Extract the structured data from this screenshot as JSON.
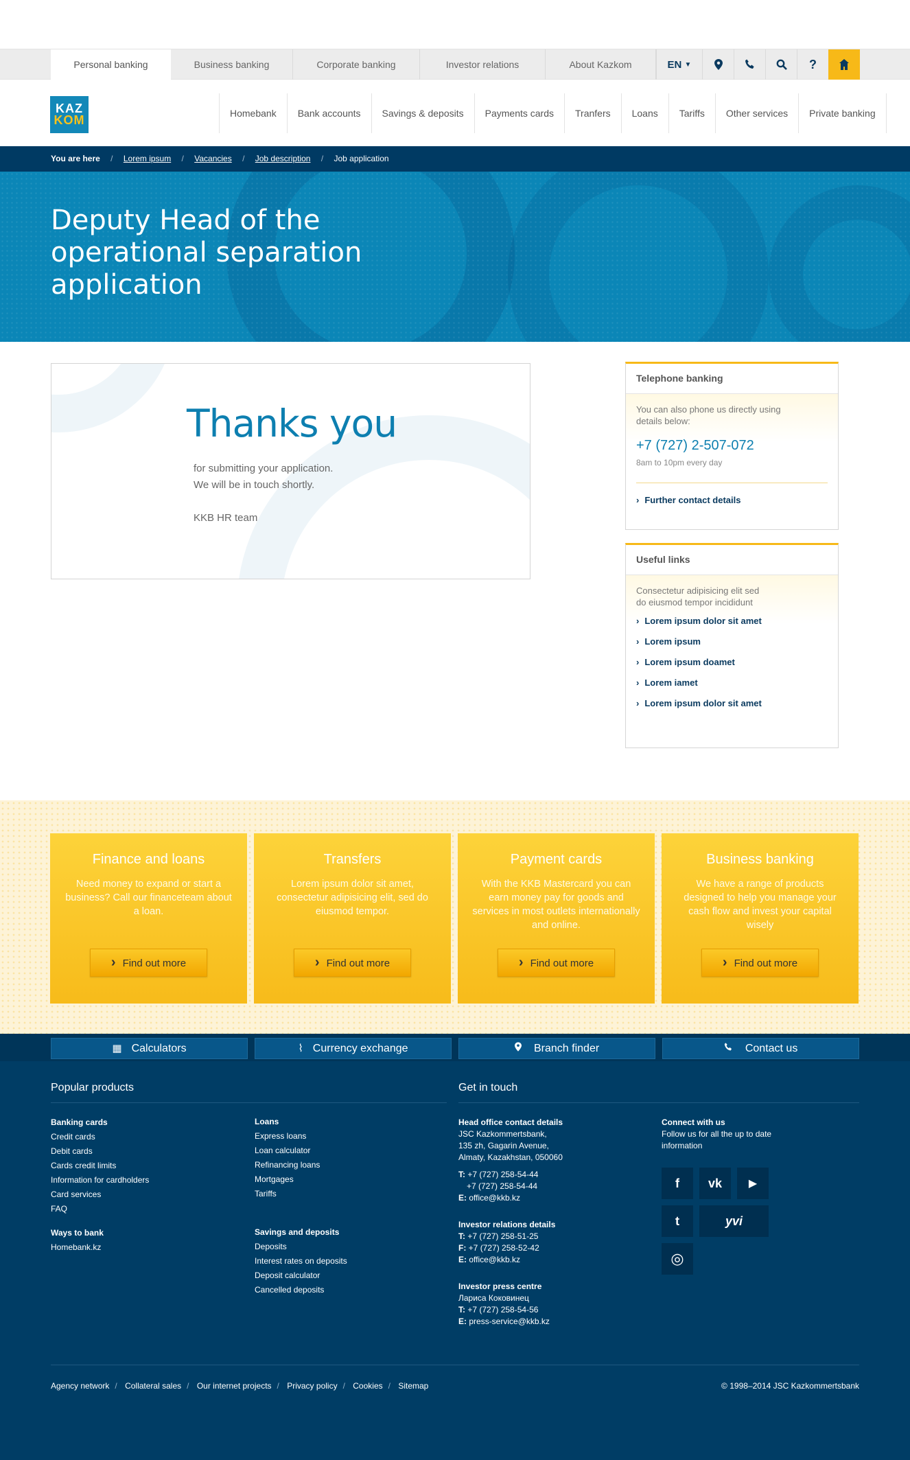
{
  "topnav": {
    "tabs": [
      "Personal banking",
      "Business banking",
      "Corporate banking",
      "Investor relations",
      "About Kazkom"
    ],
    "language": "EN",
    "icons": [
      "location-icon",
      "phone-icon",
      "search-icon",
      "help-icon",
      "home-icon"
    ]
  },
  "logo": {
    "line1": "KAZ",
    "line2": "KOM"
  },
  "mainnav": [
    "Homebank",
    "Bank accounts",
    "Savings & deposits",
    "Payments cards",
    "Tranfers",
    "Loans",
    "Tariffs",
    "Other services",
    "Private banking"
  ],
  "breadcrumbs": {
    "here": "You are here",
    "items": [
      "Lorem ipsum",
      "Vacancies",
      "Job description",
      "Job application"
    ]
  },
  "hero": {
    "title": "Deputy Head of the operational separation application"
  },
  "thanks": {
    "title": "Thanks you",
    "line1": "for submitting your application.",
    "line2": "We will be in touch shortly.",
    "signature": "KKB HR team"
  },
  "telephone": {
    "heading": "Telephone banking",
    "text": "You can also phone us directly using details below:",
    "phone": "+7 (727) 2-507-072",
    "hours": "8am to 10pm every day",
    "link": "Further contact details"
  },
  "useful": {
    "heading": "Useful links",
    "text": "Consectetur adipisicing elit sed do eiusmod tempor incididunt",
    "links": [
      "Lorem ipsum dolor sit amet",
      "Lorem ipsum",
      "Lorem ipsum doamet",
      "Lorem iamet",
      "Lorem ipsum dolor sit amet"
    ]
  },
  "promos": [
    {
      "title": "Finance and loans",
      "text": "Need money to expand or start a business? Call our financeteam about a loan.",
      "button": "Find out more"
    },
    {
      "title": "Transfers",
      "text": "Lorem ipsum dolor sit amet, consectetur adipisicing elit, sed do eiusmod tempor.",
      "button": "Find out more"
    },
    {
      "title": "Payment cards",
      "text": "With the KKB Mastercard you can earn money pay for goods and services in most outlets internationally and online.",
      "button": "Find out more"
    },
    {
      "title": "Business banking",
      "text": "We have a range of products designed to help you manage your cash flow and invest your capital wisely",
      "button": "Find out more"
    }
  ],
  "footerbar": [
    "Calculators",
    "Currency exchange",
    "Branch finder",
    "Contact us"
  ],
  "popular": {
    "heading": "Popular products",
    "banking_cards": {
      "title": "Banking cards",
      "items": [
        "Credit cards",
        "Debit cards",
        "Cards credit limits",
        "Information for cardholders",
        "Card services",
        "FAQ"
      ]
    },
    "ways": {
      "title": "Ways to bank",
      "items": [
        "Homebank.kz"
      ]
    },
    "loans": {
      "title": "Loans",
      "items": [
        "Express loans",
        "Loan calculator",
        "Refinancing loans",
        "Mortgages",
        "Tariffs"
      ]
    },
    "savings": {
      "title": "Savings and deposits",
      "items": [
        "Deposits",
        "Interest rates on deposits",
        "Deposit calculator",
        "Cancelled deposits"
      ]
    }
  },
  "contact": {
    "heading": "Get in touch",
    "head_office": {
      "title": "Head office contact details",
      "address": [
        "JSC Kazkommertsbank,",
        "135 zh, Gagarin Avenue,",
        "Almaty, Kazakhstan, 050060"
      ],
      "t1": "+7 (727) 258-54-44",
      "t2": "+7 (727) 258-54-44",
      "email": "office@kkb.kz"
    },
    "investor": {
      "title": "Investor relations details",
      "t": "+7 (727) 258-51-25",
      "f": "+7 (727) 258-52-42",
      "email": "office@kkb.kz"
    },
    "press": {
      "title": "Investor press centre",
      "name": "Лариса Коковинец",
      "t": "+7 (727) 258-54-56",
      "email": "press-service@kkb.kz"
    },
    "connect": {
      "title": "Connect with us",
      "text": "Follow us for all the up to date information"
    }
  },
  "social": {
    "facebook": "f",
    "vk": "vk",
    "youtube": "▶",
    "twitter": "t",
    "yvi": "yvi",
    "instagram": "◎"
  },
  "labels": {
    "t": "T:",
    "f": "F:",
    "e": "E:"
  },
  "bottomlinks": [
    "Agency network",
    "Collateral sales",
    "Our internet projects",
    "Privacy policy",
    "Cookies",
    "Sitemap"
  ],
  "copyright": "© 1998–2014 JSC Kazkommertsbank"
}
